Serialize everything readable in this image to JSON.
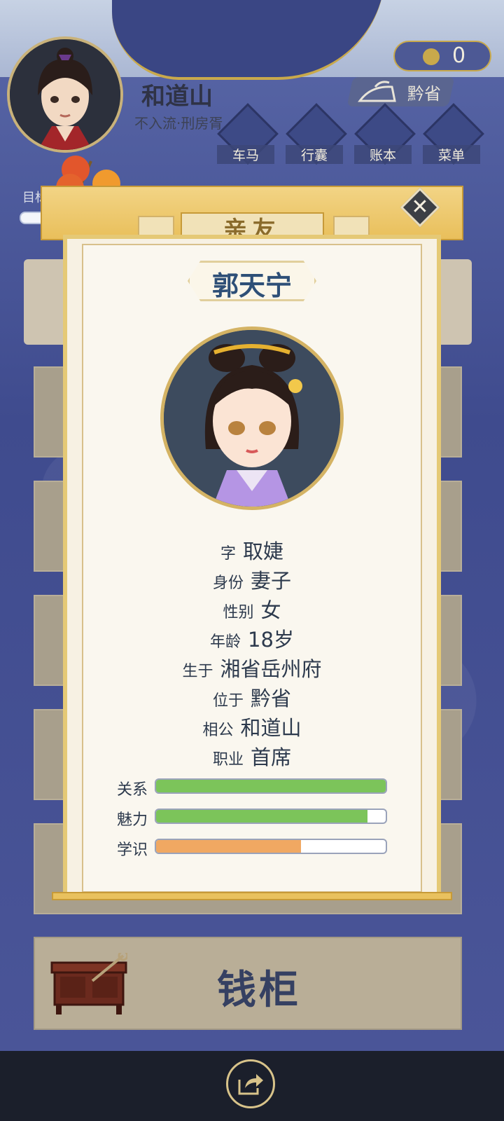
{
  "player": {
    "name": "和道山",
    "rank": "不入流·刑房胥"
  },
  "currency": {
    "value": "0"
  },
  "location": {
    "province": "黔省"
  },
  "menu": [
    {
      "label": "车马"
    },
    {
      "label": "行囊"
    },
    {
      "label": "账本"
    },
    {
      "label": "菜单"
    }
  ],
  "goal_label": "目标",
  "modal": {
    "title": "亲友",
    "npc_name": "郭天宁",
    "fields": [
      {
        "key": "字",
        "value": "取婕"
      },
      {
        "key": "身份",
        "value": "妻子"
      },
      {
        "key": "性别",
        "value": "女"
      },
      {
        "key": "年龄",
        "value": "18岁"
      },
      {
        "key": "生于",
        "value": "湘省岳州府"
      },
      {
        "key": "位于",
        "value": "黔省"
      },
      {
        "key": "相公",
        "value": "和道山"
      },
      {
        "key": "职业",
        "value": "首席"
      }
    ],
    "stats": [
      {
        "label": "关系",
        "percent": 100,
        "color": "#7cc45a"
      },
      {
        "label": "魅力",
        "percent": 92,
        "color": "#7cc45a"
      },
      {
        "label": "学识",
        "percent": 63,
        "color": "#f0a862"
      }
    ]
  },
  "cabinet": {
    "label": "钱柜"
  }
}
